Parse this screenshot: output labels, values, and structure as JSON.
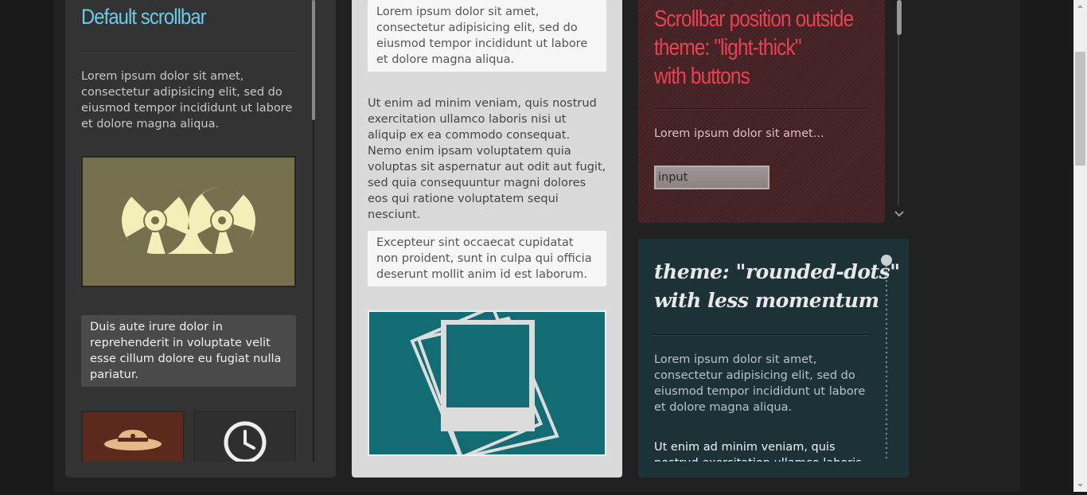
{
  "column1": {
    "title": "Default scrollbar",
    "paragraph": "Lorem ipsum dolor sit amet, consectetur adipisicing elit, sed do eiusmod tempor incididunt ut labore et dolore magna aliqua.",
    "box_text": "Duis aute irure dolor in reprehenderit in voluptate velit esse cillum dolore eu fugiat nulla pariatur.",
    "images": [
      "tape-reel",
      "hat",
      "clock"
    ]
  },
  "column2": {
    "card1": "Lorem ipsum dolor sit amet, consectetur adipisicing elit, sed do eiusmod tempor incididunt ut labore et dolore magna aliqua.",
    "paragraph": "Ut enim ad minim veniam, quis nostrud exercitation ullamco laboris nisi ut aliquip ex ea commodo consequat. Nemo enim ipsam voluptatem quia voluptas sit aspernatur aut odit aut fugit, sed quia consequuntur magni dolores eos qui ratione voluptatem sequi nesciunt.",
    "card2": "Excepteur sint occaecat cupidatat non proident, sunt in culpa qui officia deserunt mollit anim id est laborum.",
    "image": "polaroid-photos"
  },
  "column3_top": {
    "title_line1": "Scrollbar position outside",
    "title_line2": "theme: \"light-thick\"",
    "title_line3": "with buttons",
    "paragraph": "Lorem ipsum dolor sit amet...",
    "input_value": "input",
    "accent": "#e84152"
  },
  "column3_bottom": {
    "title_line1": "theme: \"rounded-dots\"",
    "title_line2": "with less momentum",
    "paragraph1": "Lorem ipsum dolor sit amet, consectetur adipisicing elit, sed do eiusmod tempor incididunt ut labore et dolore magna aliqua.",
    "paragraph2": "Ut enim ad minim veniam, quis nostrud exercitation ullamco laboris"
  },
  "colors": {
    "title_blue": "#6ccbe6",
    "dark_panel": "#333333",
    "light_panel": "#dadada",
    "teal_panel": "#1d3237",
    "maroon_panel": "#4a2528"
  }
}
